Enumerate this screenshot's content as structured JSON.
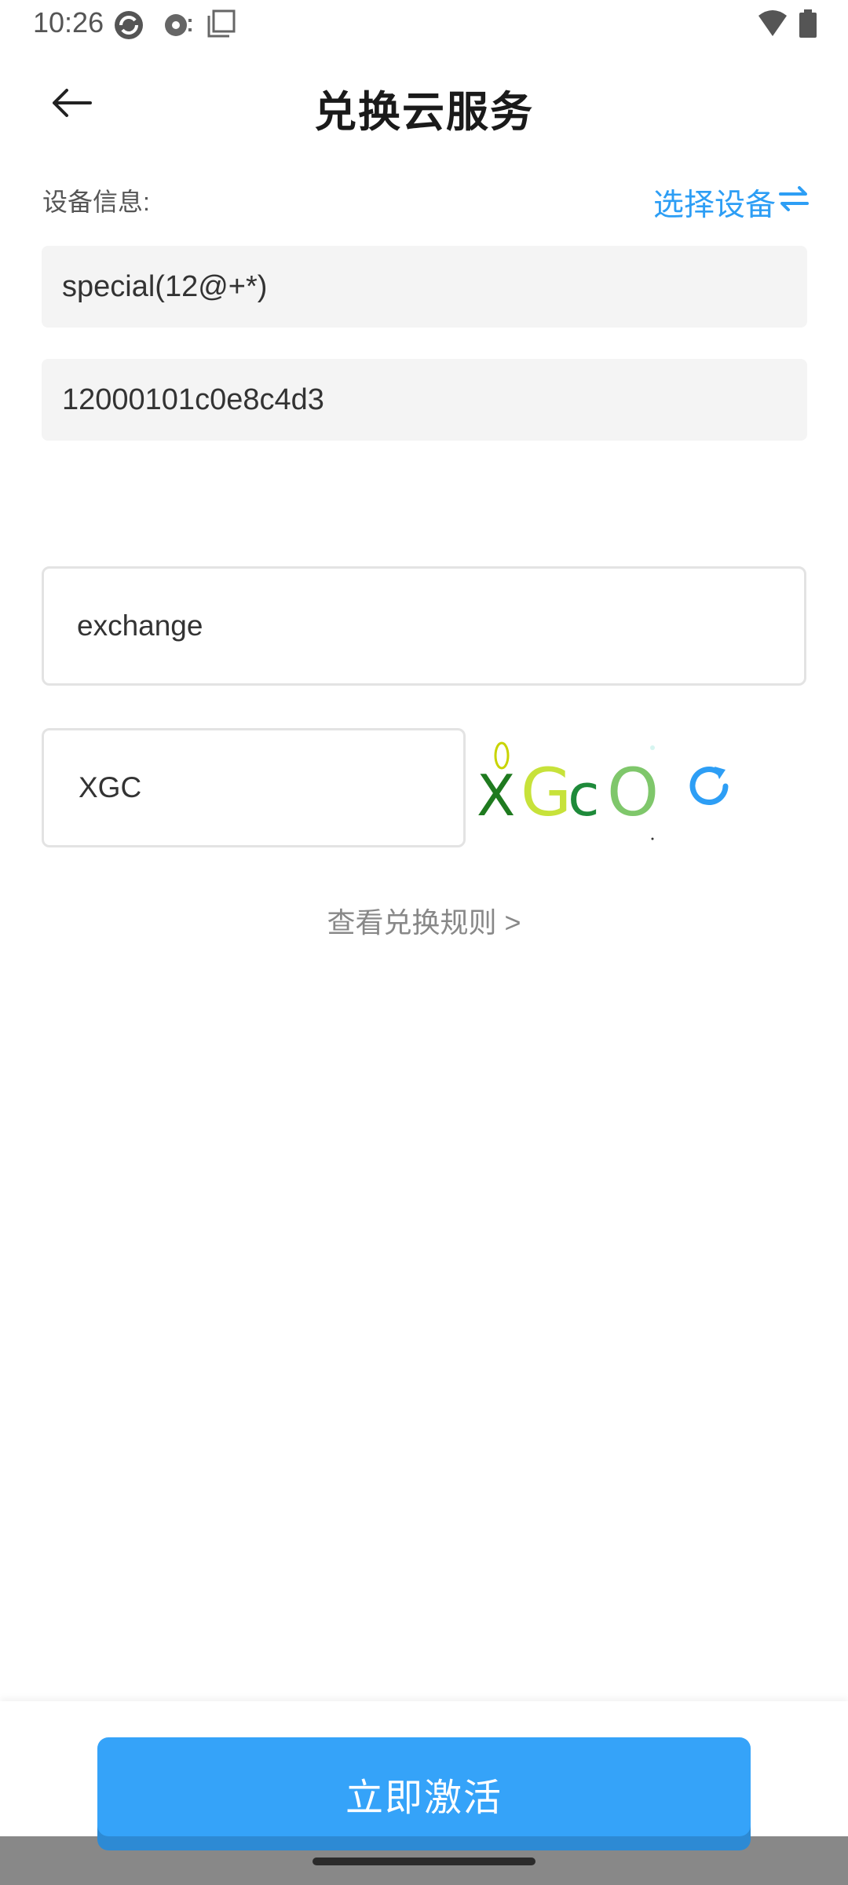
{
  "status_bar": {
    "time": "10:26"
  },
  "header": {
    "title": "兑换云服务"
  },
  "device": {
    "label": "设备信息:",
    "select_label": "选择设备",
    "name": "special(12@+*)",
    "id": "12000101c0e8c4d3"
  },
  "form": {
    "exchange_code": "exchange",
    "captcha_code": "XGC",
    "captcha_image_text": "XGcO"
  },
  "rules_link": "查看兑换规则 >",
  "activate_button": "立即激活",
  "colors": {
    "accent": "#35a3f9",
    "link_blue": "#2d9ef5"
  }
}
